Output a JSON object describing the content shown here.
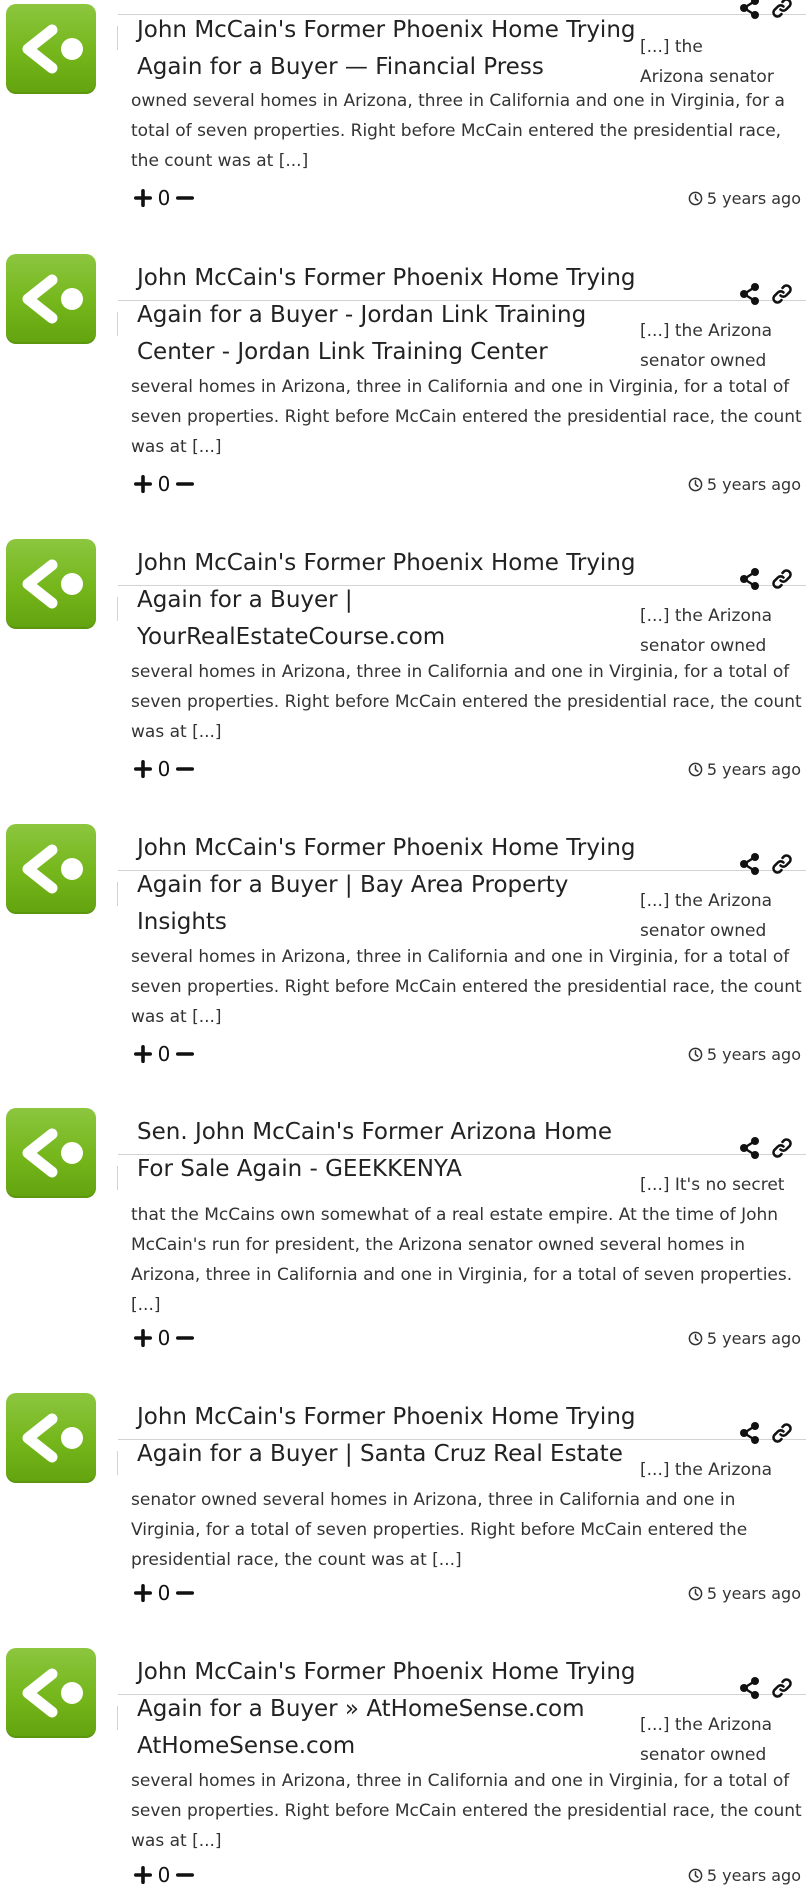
{
  "colors": {
    "avatar_green": "#74b61b",
    "divider": "#d3d3d3",
    "text": "#222222"
  },
  "icons": {
    "avatar": "back-arrow-pingback-icon",
    "share": "share-icon",
    "link": "link-icon",
    "upvote": "plus-icon",
    "downvote": "minus-icon",
    "time": "clock-icon"
  },
  "comments": [
    {
      "title_lines": [
        "John McCain's Former Phoenix Home Trying",
        "Again for a Buyer — Financial Press"
      ],
      "snippet_lines": [
        "[...] the",
        "Arizona senator"
      ],
      "body_lines": [
        "owned several homes in Arizona, three in California and one in Virginia, for a",
        "total of seven properties. Right before McCain entered the presidential race,",
        "the count was at [...]"
      ],
      "score": "0",
      "time": "5 years ago"
    },
    {
      "title_lines": [
        "John McCain's Former Phoenix Home Trying",
        "Again for a Buyer - Jordan Link Training",
        "Center - Jordan Link Training Center"
      ],
      "snippet_lines": [
        "[...] the Arizona",
        "senator owned"
      ],
      "body_lines": [
        "several homes in Arizona, three in California and one in Virginia, for a total of",
        "seven properties. Right before McCain entered the presidential race, the count",
        "was at [...]"
      ],
      "score": "0",
      "time": "5 years ago"
    },
    {
      "title_lines": [
        "John McCain's Former Phoenix Home Trying",
        "Again for a Buyer |",
        "YourRealEstateCourse.com"
      ],
      "snippet_lines": [
        "[...] the Arizona",
        "senator owned"
      ],
      "body_lines": [
        "several homes in Arizona, three in California and one in Virginia, for a total of",
        "seven properties. Right before McCain entered the presidential race, the count",
        "was at [...]"
      ],
      "score": "0",
      "time": "5 years ago"
    },
    {
      "title_lines": [
        "John McCain's Former Phoenix Home Trying",
        "Again for a Buyer | Bay Area Property",
        "Insights"
      ],
      "snippet_lines": [
        "[...] the Arizona",
        "senator owned"
      ],
      "body_lines": [
        "several homes in Arizona, three in California and one in Virginia, for a total of",
        "seven properties. Right before McCain entered the presidential race, the count",
        "was at [...]"
      ],
      "score": "0",
      "time": "5 years ago"
    },
    {
      "title_lines": [
        "Sen. John McCain's Former Arizona Home",
        "For Sale Again - GEEKKENYA"
      ],
      "snippet_lines": [
        "[...] It's no secret"
      ],
      "body_lines": [
        "that the McCains own somewhat of a real estate empire. At the time of John",
        "McCain's run for president, the Arizona senator owned several homes in",
        "Arizona, three in California and one in Virginia, for a total of seven properties.",
        "[...]"
      ],
      "score": "0",
      "time": "5 years ago"
    },
    {
      "title_lines": [
        "John McCain's Former Phoenix Home Trying",
        "Again for a Buyer | Santa Cruz Real Estate"
      ],
      "snippet_lines": [
        "[...] the Arizona"
      ],
      "body_lines": [
        "senator owned several homes in Arizona, three in California and one in",
        "Virginia, for a total of seven properties. Right before McCain entered the",
        "presidential race, the count was at [...]"
      ],
      "score": "0",
      "time": "5 years ago"
    },
    {
      "title_lines": [
        "John McCain's Former Phoenix Home Trying",
        "Again for a Buyer » AtHomeSense.com",
        "AtHomeSense.com"
      ],
      "snippet_lines": [
        "[...] the Arizona",
        "senator owned"
      ],
      "body_lines": [
        "several homes in Arizona, three in California and one in Virginia, for a total of",
        "seven properties. Right before McCain entered the presidential race, the count",
        "was at [...]"
      ],
      "score": "0",
      "time": "5 years ago"
    }
  ]
}
